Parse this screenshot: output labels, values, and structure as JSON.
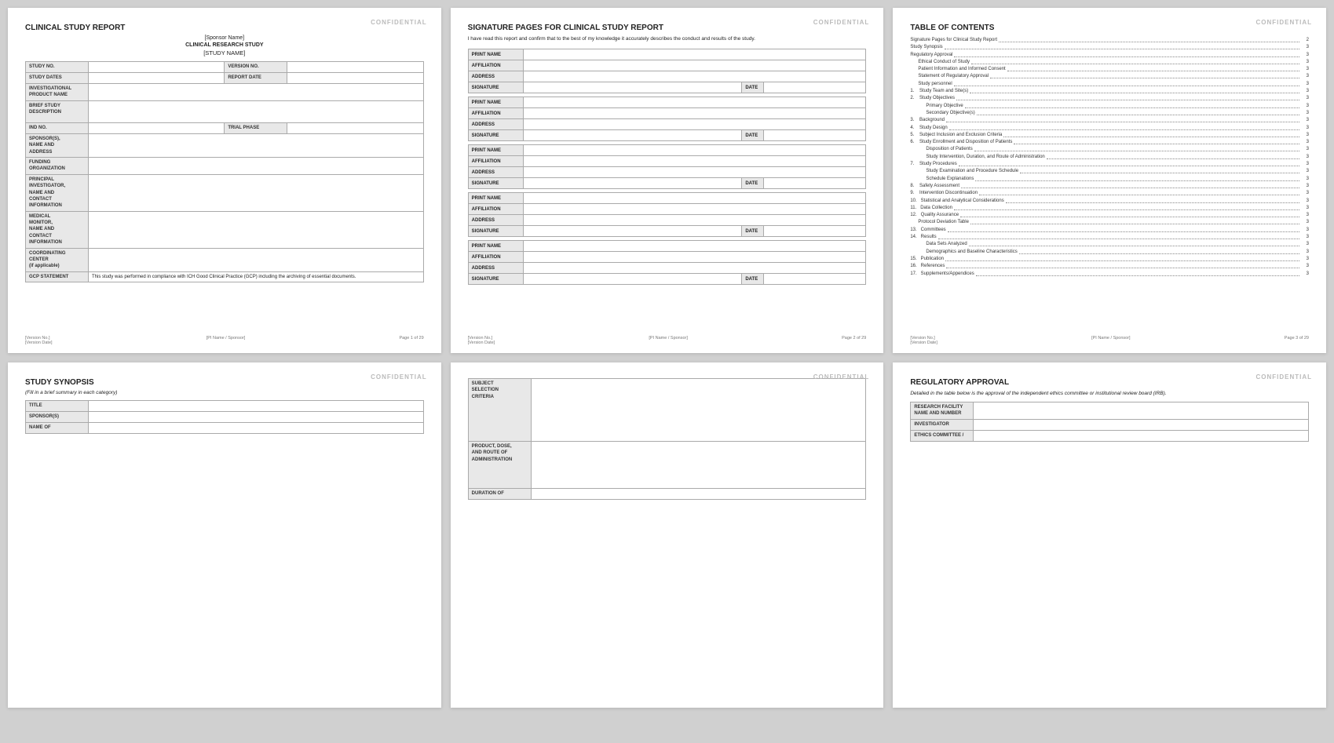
{
  "pages": [
    {
      "id": "page1",
      "confidential": "CONFIDENTIAL",
      "title": "CLINICAL STUDY REPORT",
      "subtitle1": "[Sponsor Name]",
      "subtitle2": "CLINICAL RESEARCH STUDY",
      "subtitle3": "[STUDY NAME]",
      "type": "cover",
      "fields": [
        {
          "label": "STUDY NO.",
          "value": "",
          "colspan": false,
          "extra_label": "VERSION NO.",
          "extra_value": ""
        },
        {
          "label": "STUDY DATES",
          "value": "",
          "colspan": false,
          "extra_label": "REPORT DATE",
          "extra_value": ""
        },
        {
          "label": "INVESTIGATIONAL\nPRODUCT NAME",
          "value": "",
          "colspan": true
        },
        {
          "label": "BRIEF STUDY\nDESCRIPTION",
          "value": "",
          "colspan": true,
          "tall": true
        },
        {
          "label": "IND NO.",
          "value": "",
          "colspan": false,
          "extra_label": "TRIAL PHASE",
          "extra_value": ""
        },
        {
          "label": "SPONSOR(S),\nNAME AND\nADDRESS",
          "value": "",
          "colspan": true
        },
        {
          "label": "FUNDING\nORGANIZATION",
          "value": "",
          "colspan": true
        },
        {
          "label": "PRINCIPAL\nINVESTIGATOR,\nNAME AND\nCONTACT\nINFORMATION",
          "value": "",
          "colspan": true
        },
        {
          "label": "MEDICAL\nMONITOR,\nNAME AND\nCONTACT\nINFORMATION",
          "value": "",
          "colspan": true
        },
        {
          "label": "COORDINATING\nCENTER\n(if applicable)",
          "value": "",
          "colspan": true
        },
        {
          "label": "GCP STATEMENT",
          "value": "This study was performed in compliance with ICH Good Clinical Practice (GCP) including the archiving of essential documents.",
          "colspan": true,
          "gcp": true
        }
      ],
      "footer": {
        "left1": "[Version No.]",
        "left2": "[Version Date]",
        "center": "[PI Name / Sponsor]",
        "right": "Page 1 of 29"
      }
    },
    {
      "id": "page2",
      "confidential": "CONFIDENTIAL",
      "title": "SIGNATURE PAGES FOR CLINICAL STUDY REPORT",
      "type": "signature",
      "intro": "I have read this report and confirm that to the best of my knowledge it accurately describes the conduct and results of the study.",
      "sig_groups": [
        {
          "fields": [
            "PRINT NAME",
            "AFFILIATION",
            "ADDRESS"
          ],
          "has_date": true
        },
        {
          "fields": [
            "PRINT NAME",
            "AFFILIATION",
            "ADDRESS"
          ],
          "has_date": true
        },
        {
          "fields": [
            "PRINT NAME",
            "AFFILIATION",
            "ADDRESS"
          ],
          "has_date": true
        },
        {
          "fields": [
            "PRINT NAME",
            "AFFILIATION",
            "ADDRESS"
          ],
          "has_date": true
        },
        {
          "fields": [
            "PRINT NAME",
            "AFFILIATION",
            "ADDRESS"
          ],
          "has_date": true
        }
      ],
      "footer": {
        "left1": "[Version No.]",
        "left2": "[Version Date]",
        "center": "[PI Name / Sponsor]",
        "right": "Page 2 of 29"
      }
    },
    {
      "id": "page3",
      "confidential": "CONFIDENTIAL",
      "title": "TABLE OF CONTENTS",
      "type": "toc",
      "entries": [
        {
          "label": "Signature Pages for Clinical Study Report",
          "num": "2",
          "indent": 0
        },
        {
          "label": "Study Synopsis",
          "num": "3",
          "indent": 0
        },
        {
          "label": "Regulatory Approval",
          "num": "3",
          "indent": 0
        },
        {
          "label": "Ethical Conduct of Study",
          "num": "3",
          "indent": 1
        },
        {
          "label": "Patient Information and Informed Consent",
          "num": "3",
          "indent": 1
        },
        {
          "label": "Statement of Regulatory Approval",
          "num": "3",
          "indent": 1
        },
        {
          "label": "Study personnel",
          "num": "3",
          "indent": 1
        },
        {
          "label": "1.   Study Team and Site(s)",
          "num": "3",
          "indent": 0
        },
        {
          "label": "2.   Study Objectives",
          "num": "3",
          "indent": 0
        },
        {
          "label": "Primary Objective",
          "num": "3",
          "indent": 2
        },
        {
          "label": "Secondary Objective(s)",
          "num": "3",
          "indent": 2
        },
        {
          "label": "3.   Background",
          "num": "3",
          "indent": 0
        },
        {
          "label": "4.   Study Design",
          "num": "3",
          "indent": 0
        },
        {
          "label": "5.   Subject Inclusion and Exclusion Criteria",
          "num": "3",
          "indent": 0
        },
        {
          "label": "6.   Study Enrollment and Disposition of Patients",
          "num": "3",
          "indent": 0
        },
        {
          "label": "Disposition of Patients",
          "num": "3",
          "indent": 2
        },
        {
          "label": "Study Intervention, Duration, and Route of Administration",
          "num": "3",
          "indent": 2
        },
        {
          "label": "7.   Study Procedures",
          "num": "3",
          "indent": 0
        },
        {
          "label": "Study Examination and Procedure Schedule",
          "num": "3",
          "indent": 2
        },
        {
          "label": "Schedule Explanations",
          "num": "3",
          "indent": 2
        },
        {
          "label": "8.   Safety Assessment",
          "num": "3",
          "indent": 0
        },
        {
          "label": "9.   Intervention Discontinuation",
          "num": "3",
          "indent": 0
        },
        {
          "label": "10.  Statistical and Analytical Considerations",
          "num": "3",
          "indent": 0
        },
        {
          "label": "11.  Data Collection",
          "num": "3",
          "indent": 0
        },
        {
          "label": "12.  Quality Assurance",
          "num": "3",
          "indent": 0
        },
        {
          "label": "Protocol Deviation Table",
          "num": "3",
          "indent": 1
        },
        {
          "label": "13.  Committees",
          "num": "3",
          "indent": 0
        },
        {
          "label": "14.  Results",
          "num": "3",
          "indent": 0
        },
        {
          "label": "Data Sets Analyzed",
          "num": "3",
          "indent": 2
        },
        {
          "label": "Demographics and Baseline Characteristics",
          "num": "3",
          "indent": 2
        },
        {
          "label": "15.  Publication",
          "num": "3",
          "indent": 0
        },
        {
          "label": "16.  References",
          "num": "3",
          "indent": 0
        },
        {
          "label": "17.  Supplements/Appendices",
          "num": "3",
          "indent": 0
        }
      ],
      "footer": {
        "left1": "[Version No.]",
        "left2": "[Version Date]",
        "center": "[PI Name / Sponsor]",
        "right": "Page 3 of 29"
      }
    },
    {
      "id": "page4",
      "confidential": "CONFIDENTIAL",
      "title": "STUDY SYNOPSIS",
      "type": "synopsis",
      "subtitle": "(Fill in a brief summary in each category)",
      "fields": [
        {
          "label": "TITLE",
          "value": ""
        },
        {
          "label": "SPONSOR(S)",
          "value": ""
        },
        {
          "label": "NAME OF",
          "value": ""
        }
      ],
      "footer": {
        "left1": "",
        "left2": "",
        "center": "",
        "right": ""
      }
    },
    {
      "id": "page5",
      "confidential": "CONFIDENTIAL",
      "title": "",
      "type": "criteria",
      "fields": [
        {
          "label": "SUBJECT\nSELECTION\nCRITERIA",
          "value": "",
          "tall": true
        },
        {
          "label": "PRODUCT, DOSE,\nAND ROUTE OF\nADMINISTRATION",
          "value": "",
          "tall": true
        },
        {
          "label": "DURATION OF",
          "value": ""
        }
      ],
      "footer": {
        "left1": "",
        "left2": "",
        "center": "",
        "right": ""
      }
    },
    {
      "id": "page6",
      "confidential": "CONFIDENTIAL",
      "title": "REGULATORY APPROVAL",
      "type": "regulatory",
      "intro": "Detailed in the table below is the approval of the independent ethics committee or institutional review board (IRB).",
      "fields": [
        {
          "label": "RESEARCH FACILITY\nNAME AND NUMBER",
          "value": ""
        },
        {
          "label": "INVESTIGATOR",
          "value": ""
        },
        {
          "label": "ETHICS COMMITTEE /",
          "value": ""
        }
      ],
      "footer": {
        "left1": "",
        "left2": "",
        "center": "",
        "right": ""
      }
    }
  ]
}
